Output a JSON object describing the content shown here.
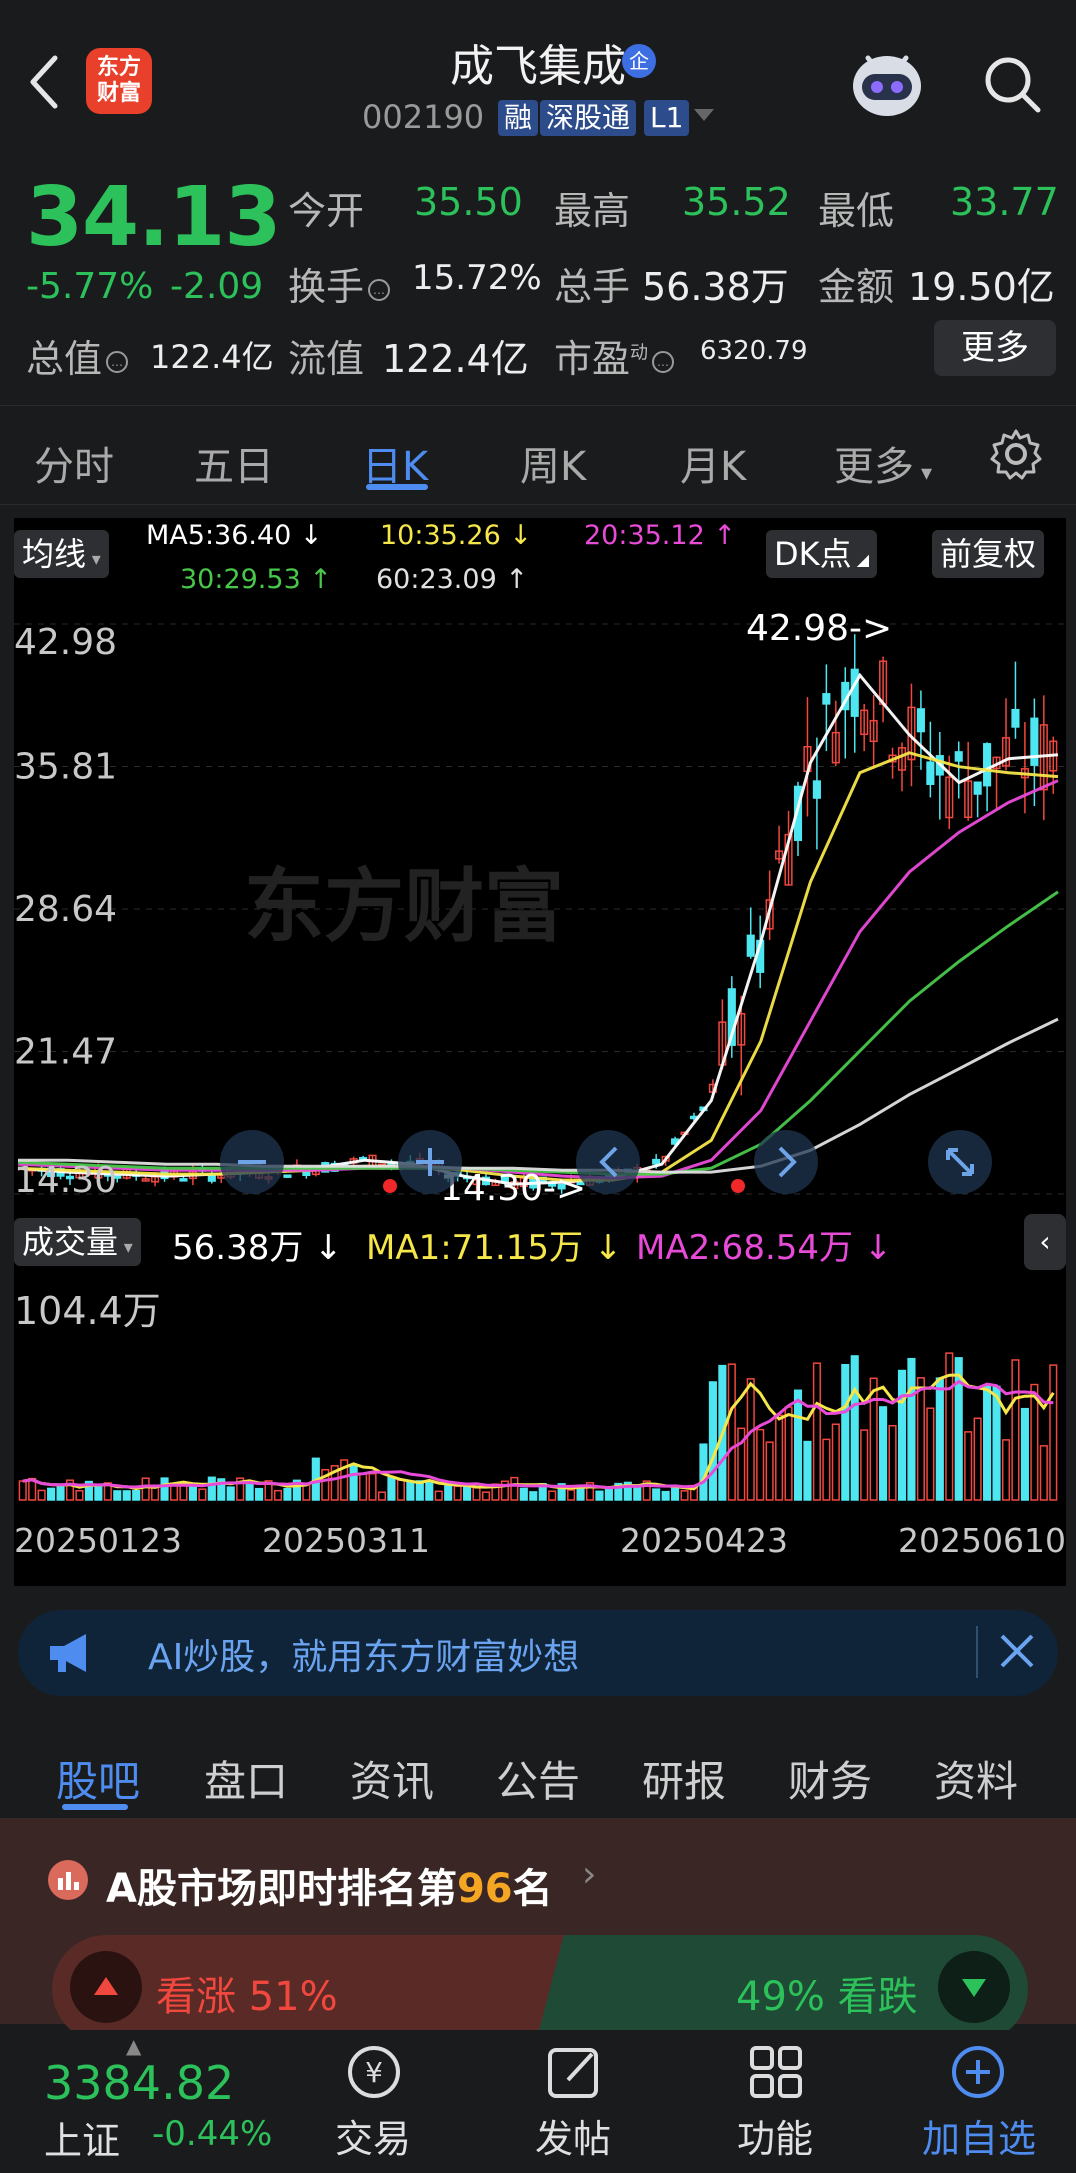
{
  "header": {
    "logo_text_1": "东方",
    "logo_text_2": "财富",
    "stock_name": "成飞集成",
    "stock_badge": "企",
    "stock_code": "002190",
    "tags": [
      "融",
      "深股通",
      "L1"
    ]
  },
  "quote": {
    "price": "34.13",
    "change_pct": "-5.77%",
    "change": "-2.09",
    "open_label": "今开",
    "open": "35.50",
    "high_label": "最高",
    "high": "35.52",
    "low_label": "最低",
    "low": "33.77",
    "turnover_label": "换手",
    "turnover": "15.72%",
    "volume_label": "总手",
    "volume": "56.38万",
    "amount_label": "金额",
    "amount": "19.50亿",
    "mktcap_label": "总值",
    "mktcap": "122.4亿",
    "float_label": "流值",
    "float": "122.4亿",
    "pe_label": "市盈",
    "pe_sup": "动",
    "pe": "6320.79",
    "more_button": "更多"
  },
  "tabs": [
    "分时",
    "五日",
    "日K",
    "周K",
    "月K",
    "更多"
  ],
  "active_tab": "日K",
  "kline": {
    "ma_chip": "均线",
    "ma5": "MA5:36.40 ↓",
    "ma10": "10:35.26 ↓",
    "ma20": "20:35.12 ↑",
    "ma30": "30:29.53 ↑",
    "ma60": "60:23.09 ↑",
    "dk_chip": "DK点",
    "adjust_chip": "前复权",
    "watermark": "东方财富",
    "y_ticks": [
      "42.98",
      "35.81",
      "28.64",
      "21.47",
      "14.30"
    ],
    "max_label": "42.98->",
    "min_label": "14.30->"
  },
  "volume": {
    "chip": "成交量",
    "vol": "56.38万 ↓",
    "ma1": "MA1:71.15万 ↓",
    "ma2": "MA2:68.54万 ↓",
    "y_max": "104.4万",
    "x_ticks": [
      "20250123",
      "20250311",
      "20250423",
      "20250610"
    ]
  },
  "ai_banner": "AI炒股，就用东方财富妙想",
  "bottom_tabs": [
    "股吧",
    "盘口",
    "资讯",
    "公告",
    "研报",
    "财务",
    "资料"
  ],
  "active_bottom_tab": "股吧",
  "rank": {
    "prefix": "A股市场即时排名第",
    "number": "96",
    "suffix": "名",
    "bull_label": "看涨 51%",
    "bear_label": "49% 看跌",
    "bull_pct": 51
  },
  "dock": {
    "index_value": "3384.82",
    "index_name": "上证",
    "index_change": "-0.44%",
    "items": [
      "交易",
      "发帖",
      "功能",
      "加自选"
    ]
  },
  "colors": {
    "up": "#f0483e",
    "down": "#2cc15a",
    "accent": "#4e8cf0",
    "candle_down": "#4ee6f0"
  },
  "chart_data": {
    "type": "line",
    "title": "",
    "ylabel": "",
    "ylim": [
      14.3,
      42.98
    ],
    "x_ticks": [
      "20250123",
      "20250311",
      "20250423",
      "20250610"
    ],
    "series": [
      {
        "name": "MA5",
        "values": [
          15.6,
          15.4,
          15.3,
          15.2,
          15.3,
          15.4,
          15.6,
          16.0,
          15.8,
          15.2,
          14.8,
          14.9,
          15.1,
          15.8,
          19.0,
          27.0,
          36.0,
          40.4,
          37.4,
          35.0,
          36.2,
          36.4
        ]
      },
      {
        "name": "MA10",
        "values": [
          15.6,
          15.5,
          15.4,
          15.3,
          15.3,
          15.4,
          15.5,
          15.7,
          15.7,
          15.5,
          15.2,
          15.0,
          15.0,
          15.4,
          17.0,
          22.0,
          30.0,
          35.5,
          36.5,
          35.8,
          35.5,
          35.3
        ]
      },
      {
        "name": "MA20",
        "values": [
          15.8,
          15.7,
          15.6,
          15.5,
          15.5,
          15.5,
          15.5,
          15.6,
          15.6,
          15.6,
          15.4,
          15.2,
          15.1,
          15.2,
          16.0,
          18.5,
          23.0,
          27.5,
          30.5,
          32.5,
          34.0,
          35.1
        ]
      },
      {
        "name": "MA30",
        "values": [
          15.9,
          15.8,
          15.7,
          15.6,
          15.6,
          15.6,
          15.6,
          15.6,
          15.6,
          15.6,
          15.5,
          15.4,
          15.3,
          15.3,
          15.6,
          16.8,
          19.0,
          21.5,
          24.0,
          26.0,
          27.8,
          29.5
        ]
      },
      {
        "name": "MA60",
        "values": [
          16.0,
          16.0,
          15.9,
          15.8,
          15.8,
          15.7,
          15.7,
          15.7,
          15.7,
          15.6,
          15.6,
          15.5,
          15.5,
          15.4,
          15.4,
          15.7,
          16.5,
          17.8,
          19.3,
          20.6,
          21.9,
          23.1
        ]
      }
    ]
  }
}
